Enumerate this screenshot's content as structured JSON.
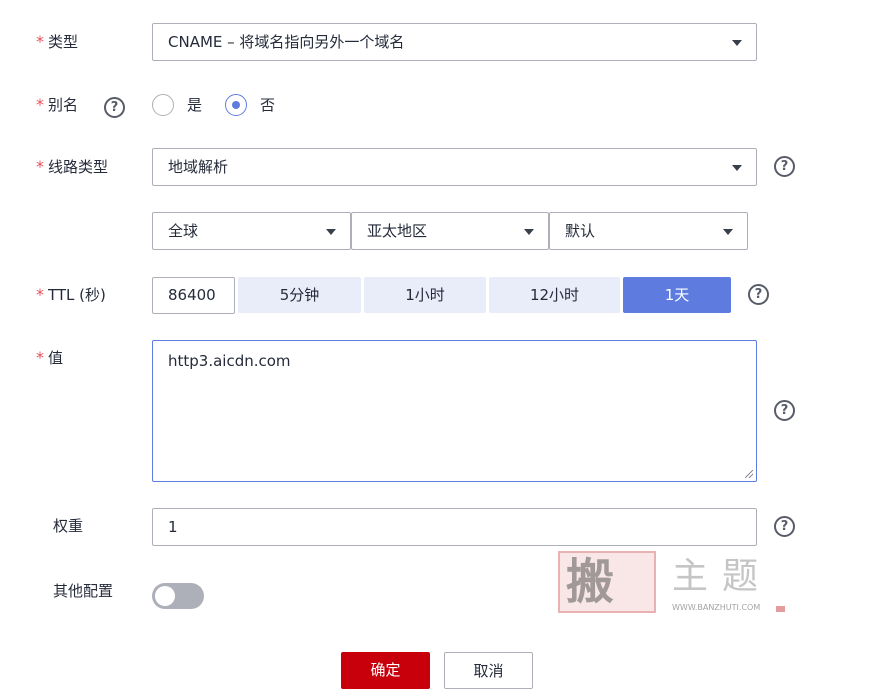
{
  "fields": {
    "type": {
      "label": "类型",
      "value": "CNAME – 将域名指向另外一个域名"
    },
    "alias": {
      "label": "别名",
      "help_icon": "question-circle-icon",
      "options": [
        {
          "label": "是",
          "selected": false
        },
        {
          "label": "否",
          "selected": true
        }
      ]
    },
    "line_type": {
      "label": "线路类型",
      "value": "地域解析",
      "help_icon": "question-circle-icon"
    },
    "region": {
      "scope": "全球",
      "area": "亚太地区",
      "detail": "默认"
    },
    "ttl": {
      "label": "TTL (秒)",
      "value": "86400",
      "presets": [
        {
          "label": "5分钟",
          "active": false
        },
        {
          "label": "1小时",
          "active": false
        },
        {
          "label": "12小时",
          "active": false
        },
        {
          "label": "1天",
          "active": true
        }
      ],
      "help_icon": "question-circle-icon"
    },
    "value": {
      "label": "值",
      "value": "http3.aicdn.com",
      "help_icon": "question-circle-icon"
    },
    "weight": {
      "label": "权重",
      "value": "1",
      "help_icon": "question-circle-icon"
    },
    "other_config": {
      "label": "其他配置",
      "enabled": false
    }
  },
  "required_mark": "*",
  "help_glyph": "?",
  "buttons": {
    "confirm": "确定",
    "cancel": "取消"
  },
  "watermark": {
    "seal": "搬",
    "brand": "主题",
    "url": "WWW.BANZHUTI.COM"
  },
  "colors": {
    "accent": "#5e7ce0",
    "required": "#e6505a",
    "primary_button": "#c7000b",
    "preset_bg": "#e9edfa"
  }
}
